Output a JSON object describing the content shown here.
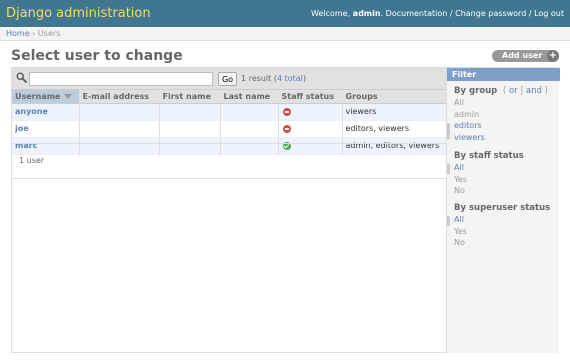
{
  "header": {
    "branding": "Django administration",
    "welcome": "Welcome,",
    "username": "admin",
    "links": [
      "Documentation",
      "Change password",
      "Log out"
    ],
    "separator": " / "
  },
  "breadcrumbs": {
    "home": "Home",
    "separator": "›",
    "current": "Users"
  },
  "page": {
    "title": "Select user to change",
    "add_button": "Add user",
    "add_icon": "+"
  },
  "toolbar": {
    "search_value": "",
    "go_label": "Go",
    "result_text": "1 result",
    "total_text": "4 total"
  },
  "table": {
    "columns": [
      "Username",
      "E-mail address",
      "First name",
      "Last name",
      "Staff status",
      "Groups"
    ],
    "rows": [
      {
        "username": "anyone",
        "email": "",
        "first_name": "",
        "last_name": "",
        "staff": "no",
        "groups": "viewers"
      },
      {
        "username": "joe",
        "email": "",
        "first_name": "",
        "last_name": "",
        "staff": "no",
        "groups": "editors, viewers"
      },
      {
        "username": "marc",
        "email": "",
        "first_name": "",
        "last_name": "",
        "staff": "yes",
        "groups": "admin, editors, viewers"
      }
    ]
  },
  "paginator": "1 user",
  "filter": {
    "title": "Filter",
    "by_group": {
      "label": "By group",
      "or": "or",
      "and": "and",
      "items": [
        "All",
        "admin",
        "editors",
        "viewers"
      ]
    },
    "by_staff": {
      "label": "By staff status",
      "items": [
        "All",
        "Yes",
        "No"
      ]
    },
    "by_superuser": {
      "label": "By superuser status",
      "items": [
        "All",
        "Yes",
        "No"
      ]
    }
  },
  "colors": {
    "header_bg": "#417690",
    "branding": "#f5dd5d",
    "link": "#5b80b2",
    "filter_title_bg": "#7ca0c7",
    "staff_no": "#dd4646",
    "staff_yes": "#4aa84a"
  }
}
